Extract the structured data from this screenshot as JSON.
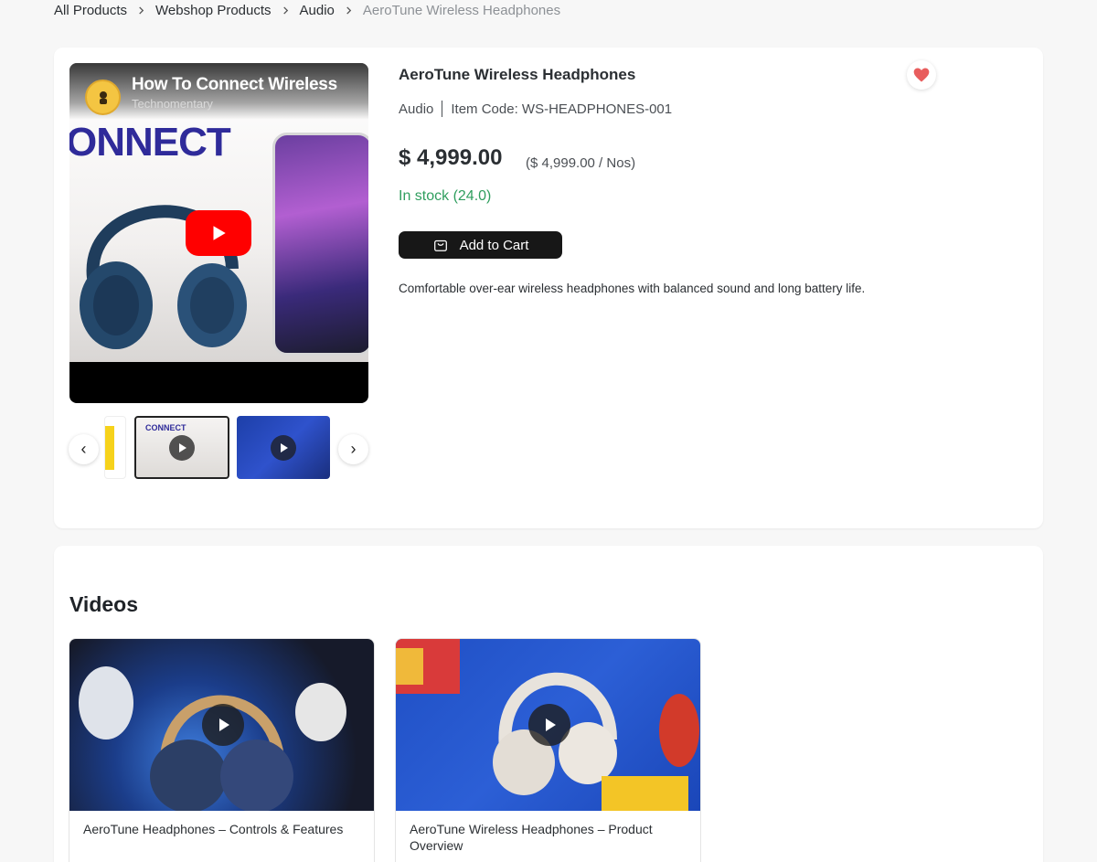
{
  "breadcrumb": {
    "items": [
      "All Products",
      "Webshop Products",
      "Audio"
    ],
    "current": "AeroTune Wireless Headphones"
  },
  "media": {
    "video_title": "How To Connect Wireless",
    "video_channel": "Technomentary",
    "overlay_text": "ONNECT",
    "thumb_overlay_text": "CONNECT",
    "prev_label": "‹",
    "next_label": "›"
  },
  "product": {
    "title": "AeroTune Wireless Headphones",
    "category": "Audio",
    "item_code": "Item Code: WS-HEADPHONES-001",
    "price": "$ 4,999.00",
    "unit_price": "($ 4,999.00 / Nos)",
    "stock": "In stock (24.0)",
    "add_to_cart_label": "Add to Cart",
    "description": "Comfortable over-ear wireless headphones with balanced sound and long battery life."
  },
  "videos": {
    "heading": "Videos",
    "items": [
      {
        "caption": "AeroTune Headphones – Controls & Features"
      },
      {
        "caption": "AeroTune Wireless Headphones – Product Overview"
      }
    ]
  },
  "colors": {
    "stock_green": "#2f9e5e",
    "cart_button": "#171717",
    "wishlist_heart": "#e85d5d",
    "youtube_red": "#ff0000"
  }
}
